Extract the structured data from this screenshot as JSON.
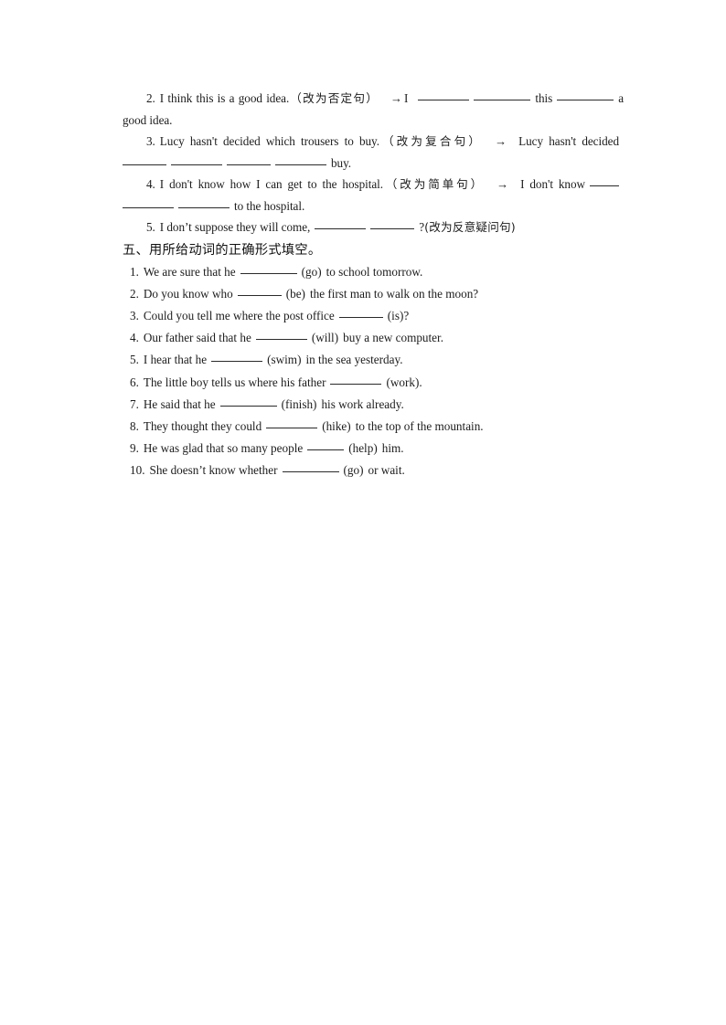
{
  "document": {
    "background_color": "#ffffff",
    "text_color": "#1c1c1c",
    "rule_color": "#2a2a2a"
  },
  "exercises_part_four": {
    "items": [
      {
        "number": "2.",
        "sentence": "I think this is a good idea.",
        "instruction": "（改为否定句）",
        "arrow": "→",
        "answer_lead": "I",
        "answer_mid": "this",
        "answer_tail": "a good idea."
      },
      {
        "number": "3.",
        "sentence": "Lucy hasn't decided which trousers to buy.",
        "instruction": "（改为复合句）",
        "arrow": "→",
        "answer_lead": "Lucy hasn't decided",
        "answer_tail": "buy."
      },
      {
        "number": "4.",
        "sentence": "I don't know how I can get to the hospital.",
        "instruction": "（改为简单句）",
        "arrow": "→",
        "answer_lead": "I don't know",
        "answer_tail": "to the hospital."
      },
      {
        "number": "5.",
        "sentence": "I don’t suppose they will come,",
        "question_mark": "?",
        "instruction": "(改为反意疑问句)"
      }
    ]
  },
  "section_five": {
    "heading": "五、用所给动词的正确形式填空。",
    "questions": [
      {
        "number": "1.",
        "before": "We are sure that he",
        "hint": "(go)",
        "after": "to school tomorrow."
      },
      {
        "number": "2.",
        "before": "Do you know who",
        "hint": "(be)",
        "after": "the first man to walk on the moon?"
      },
      {
        "number": "3.",
        "before": "Could you tell me where the post office",
        "hint": "(is)?",
        "after": ""
      },
      {
        "number": "4.",
        "before": "Our father said that he",
        "hint": "(will)",
        "after": "buy a new computer."
      },
      {
        "number": "5.",
        "before": "I hear that he",
        "hint": "(swim)",
        "after": "in the sea yesterday."
      },
      {
        "number": "6.",
        "before": "The little boy tells us where his father",
        "hint": "(work).",
        "after": ""
      },
      {
        "number": "7.",
        "before": "He said that he",
        "hint": "(finish)",
        "after": "his work already."
      },
      {
        "number": "8.",
        "before": "They thought they could",
        "hint": "(hike)",
        "after": "to the top of the mountain."
      },
      {
        "number": "9.",
        "before": "He was glad that so many people",
        "hint": "(help)",
        "after": "him."
      },
      {
        "number": "10.",
        "before": "She doesn’t know whether",
        "hint": "(go)",
        "after": "or wait."
      }
    ]
  }
}
